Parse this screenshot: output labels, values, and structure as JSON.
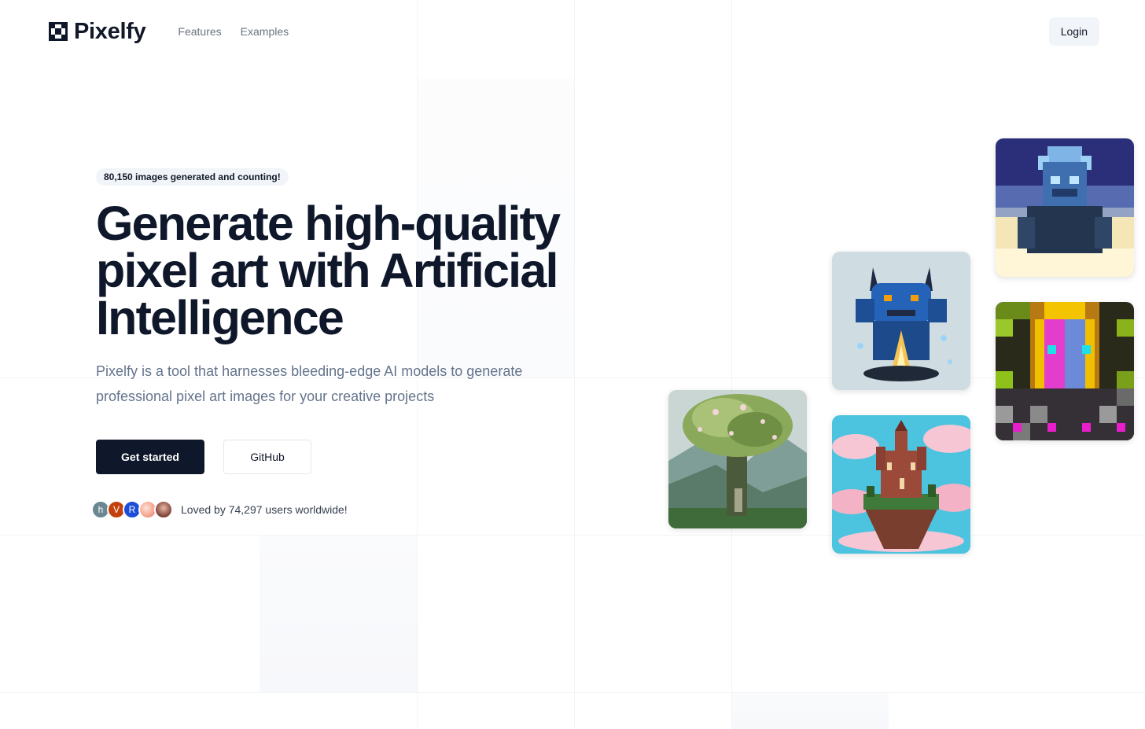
{
  "header": {
    "logo_text": "Pixelfy",
    "nav": [
      {
        "label": "Features"
      },
      {
        "label": "Examples"
      }
    ],
    "login_label": "Login"
  },
  "hero": {
    "badge": "80,150 images generated and counting!",
    "headline": "Generate high-quality pixel art with Artificial Intelligence",
    "subtitle": "Pixelfy is a tool that harnesses bleeding-edge AI models to generate professional pixel art images for your creative projects",
    "primary_cta": "Get started",
    "secondary_cta": "GitHub",
    "avatars": [
      {
        "initial": "h",
        "color": "#6b8791"
      },
      {
        "initial": "V",
        "color": "#c2410c"
      },
      {
        "initial": "R",
        "color": "#1d4ed8"
      },
      {
        "initial": "",
        "color": "#f4a28c"
      },
      {
        "initial": "",
        "color": "#7c3f35"
      }
    ],
    "social_proof": "Loved by 74,297 users worldwide!"
  },
  "gallery": [
    {
      "name": "pixel-art-tree"
    },
    {
      "name": "pixel-art-blue-dragon"
    },
    {
      "name": "pixel-art-floating-castle"
    },
    {
      "name": "pixel-art-ice-demon"
    },
    {
      "name": "pixel-art-magenta-portal"
    }
  ],
  "colors": {
    "primary": "#0f172a",
    "muted_text": "#64748b",
    "badge_bg": "#f1f5f9"
  }
}
